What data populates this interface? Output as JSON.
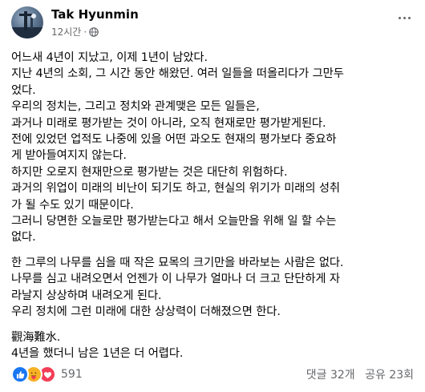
{
  "post": {
    "author": "Tak Hyunmin",
    "time": "12시간",
    "dot": "·",
    "privacy_icon": "globe-icon",
    "more_icon": "more-options-icon"
  },
  "body": {
    "lines": [
      "어느새 4년이 지났고, 이제 1년이 남았다.",
      "지난 4년의 소회, 그 시간 동안 해왔던. 여러 일들을 떠올리다가 그만두",
      "었다.",
      "우리의 정치는, 그리고 정치와 관계맺은 모든 일들은,",
      "과거나 미래로 평가받는 것이 아니라, 오직 현재로만 평가받게된다.",
      "전에 있었던 업적도 나중에 있을 어떤 과오도 현재의 평가보다 중요하",
      "게 받아들여지지 않는다.",
      "하지만 오로지 현재만으로 평가받는 것은 대단히 위험하다.",
      "과거의 위업이 미래의 비난이 되기도 하고, 현실의 위기가 미래의 성취",
      "가 될 수도 있기 때문이다.",
      "그러니 당면한 오늘로만 평가받는다고 해서 오늘만을 위해 일 할 수는",
      "없다."
    ],
    "lines2": [
      "한 그루의 나무를 심을 때 작은 묘목의 크기만을 바라보는 사람은 없다.",
      "나무를 심고 내려오면서 언젠가 이 나무가 얼마나 더 크고 단단하게 자",
      "라날지 상상하며 내려오게 된다.",
      "우리 정치에 그런 미래에 대한 상상력이 더해졌으면 한다."
    ],
    "lines3": [
      "觀海難水.",
      "4년을 했더니 남은 1년은 더 어렵다."
    ]
  },
  "footer": {
    "reaction_icons": [
      "like-icon",
      "care-icon",
      "love-icon"
    ],
    "reaction_count": "591",
    "comments": "댓글 32개",
    "shares": "공유 23회"
  },
  "colors": {
    "text": "#050505",
    "secondary": "#65676b",
    "like": "#1877f2",
    "care": "#f7b125",
    "love": "#f33e58"
  }
}
